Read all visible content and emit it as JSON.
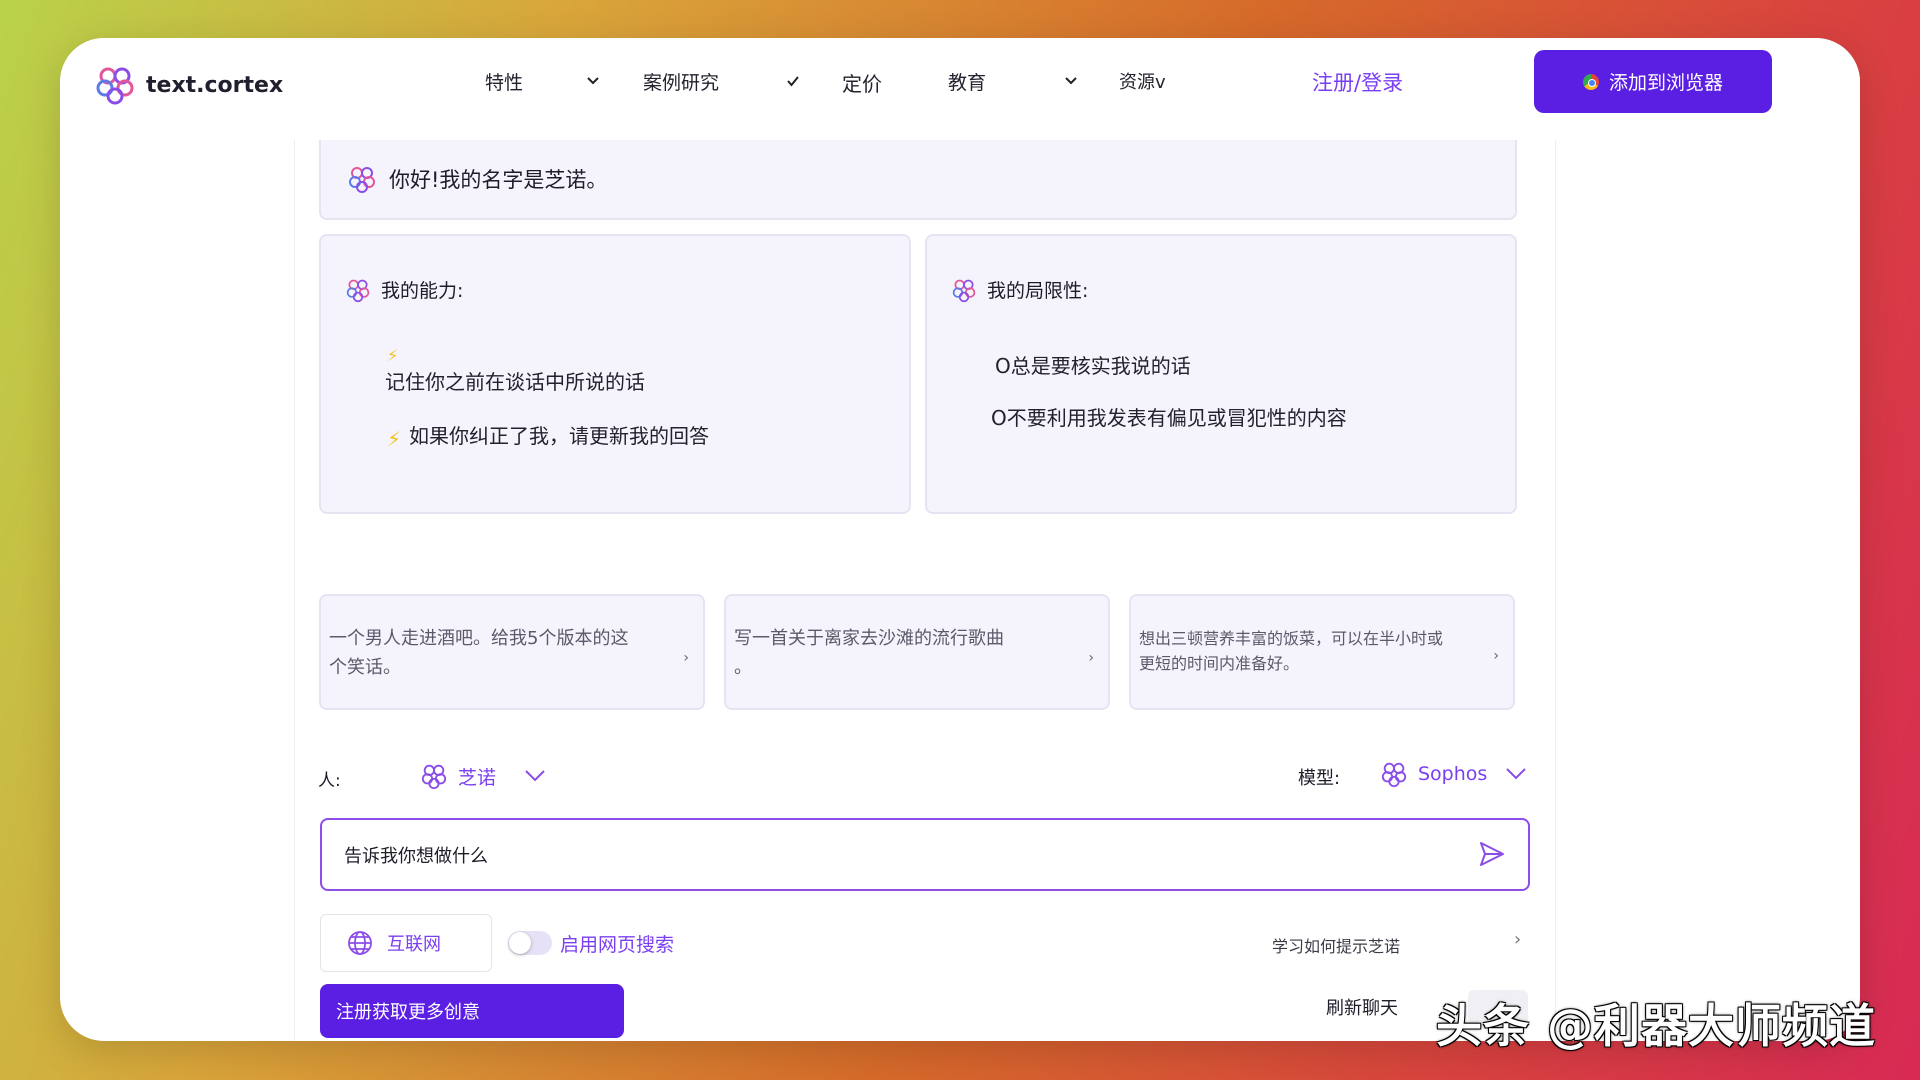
{
  "nav": {
    "logo_text": "text.cortex",
    "items": [
      "特性",
      "案例研究",
      "定价",
      "教育",
      "资源v"
    ],
    "login": "注册/登录",
    "cta": "添加到浏览器"
  },
  "greeting": "你好!我的名字是芝诺。",
  "capabilities": {
    "title": "我的能力:",
    "items": [
      "记住你之前在谈话中所说的话",
      "如果你纠正了我，请更新我的回答"
    ]
  },
  "limitations": {
    "title": "我的局限性:",
    "items": [
      "O总是要核实我说的话",
      "O不要利用我发表有偏见或冒犯性的内容"
    ]
  },
  "suggestions": [
    {
      "line1": "一个男人走进酒吧。给我5个版本的这",
      "line2": "个笑话。"
    },
    {
      "line1": "写一首关于离家去沙滩的流行歌曲",
      "line2": "。"
    },
    {
      "line1": "想出三顿营养丰富的饭菜，可以在半小时或",
      "line2": "更短的时间内准备好。"
    }
  ],
  "persona": {
    "label": "人:",
    "value": "芝诺"
  },
  "model": {
    "label": "模型:",
    "value": "Sophos"
  },
  "prompt": {
    "placeholder": "告诉我你想做什么"
  },
  "bottom": {
    "internet": "互联网",
    "web_search": "启用网页搜索",
    "learn": "学习如何提示芝诺",
    "signup": "注册获取更多创意",
    "refresh": "刷新聊天"
  },
  "watermark": "头条 @利器大师频道",
  "colors": {
    "accent": "#5b1ee3",
    "accent_text": "#7b3ff2",
    "card_bg": "#f5f4fc"
  }
}
